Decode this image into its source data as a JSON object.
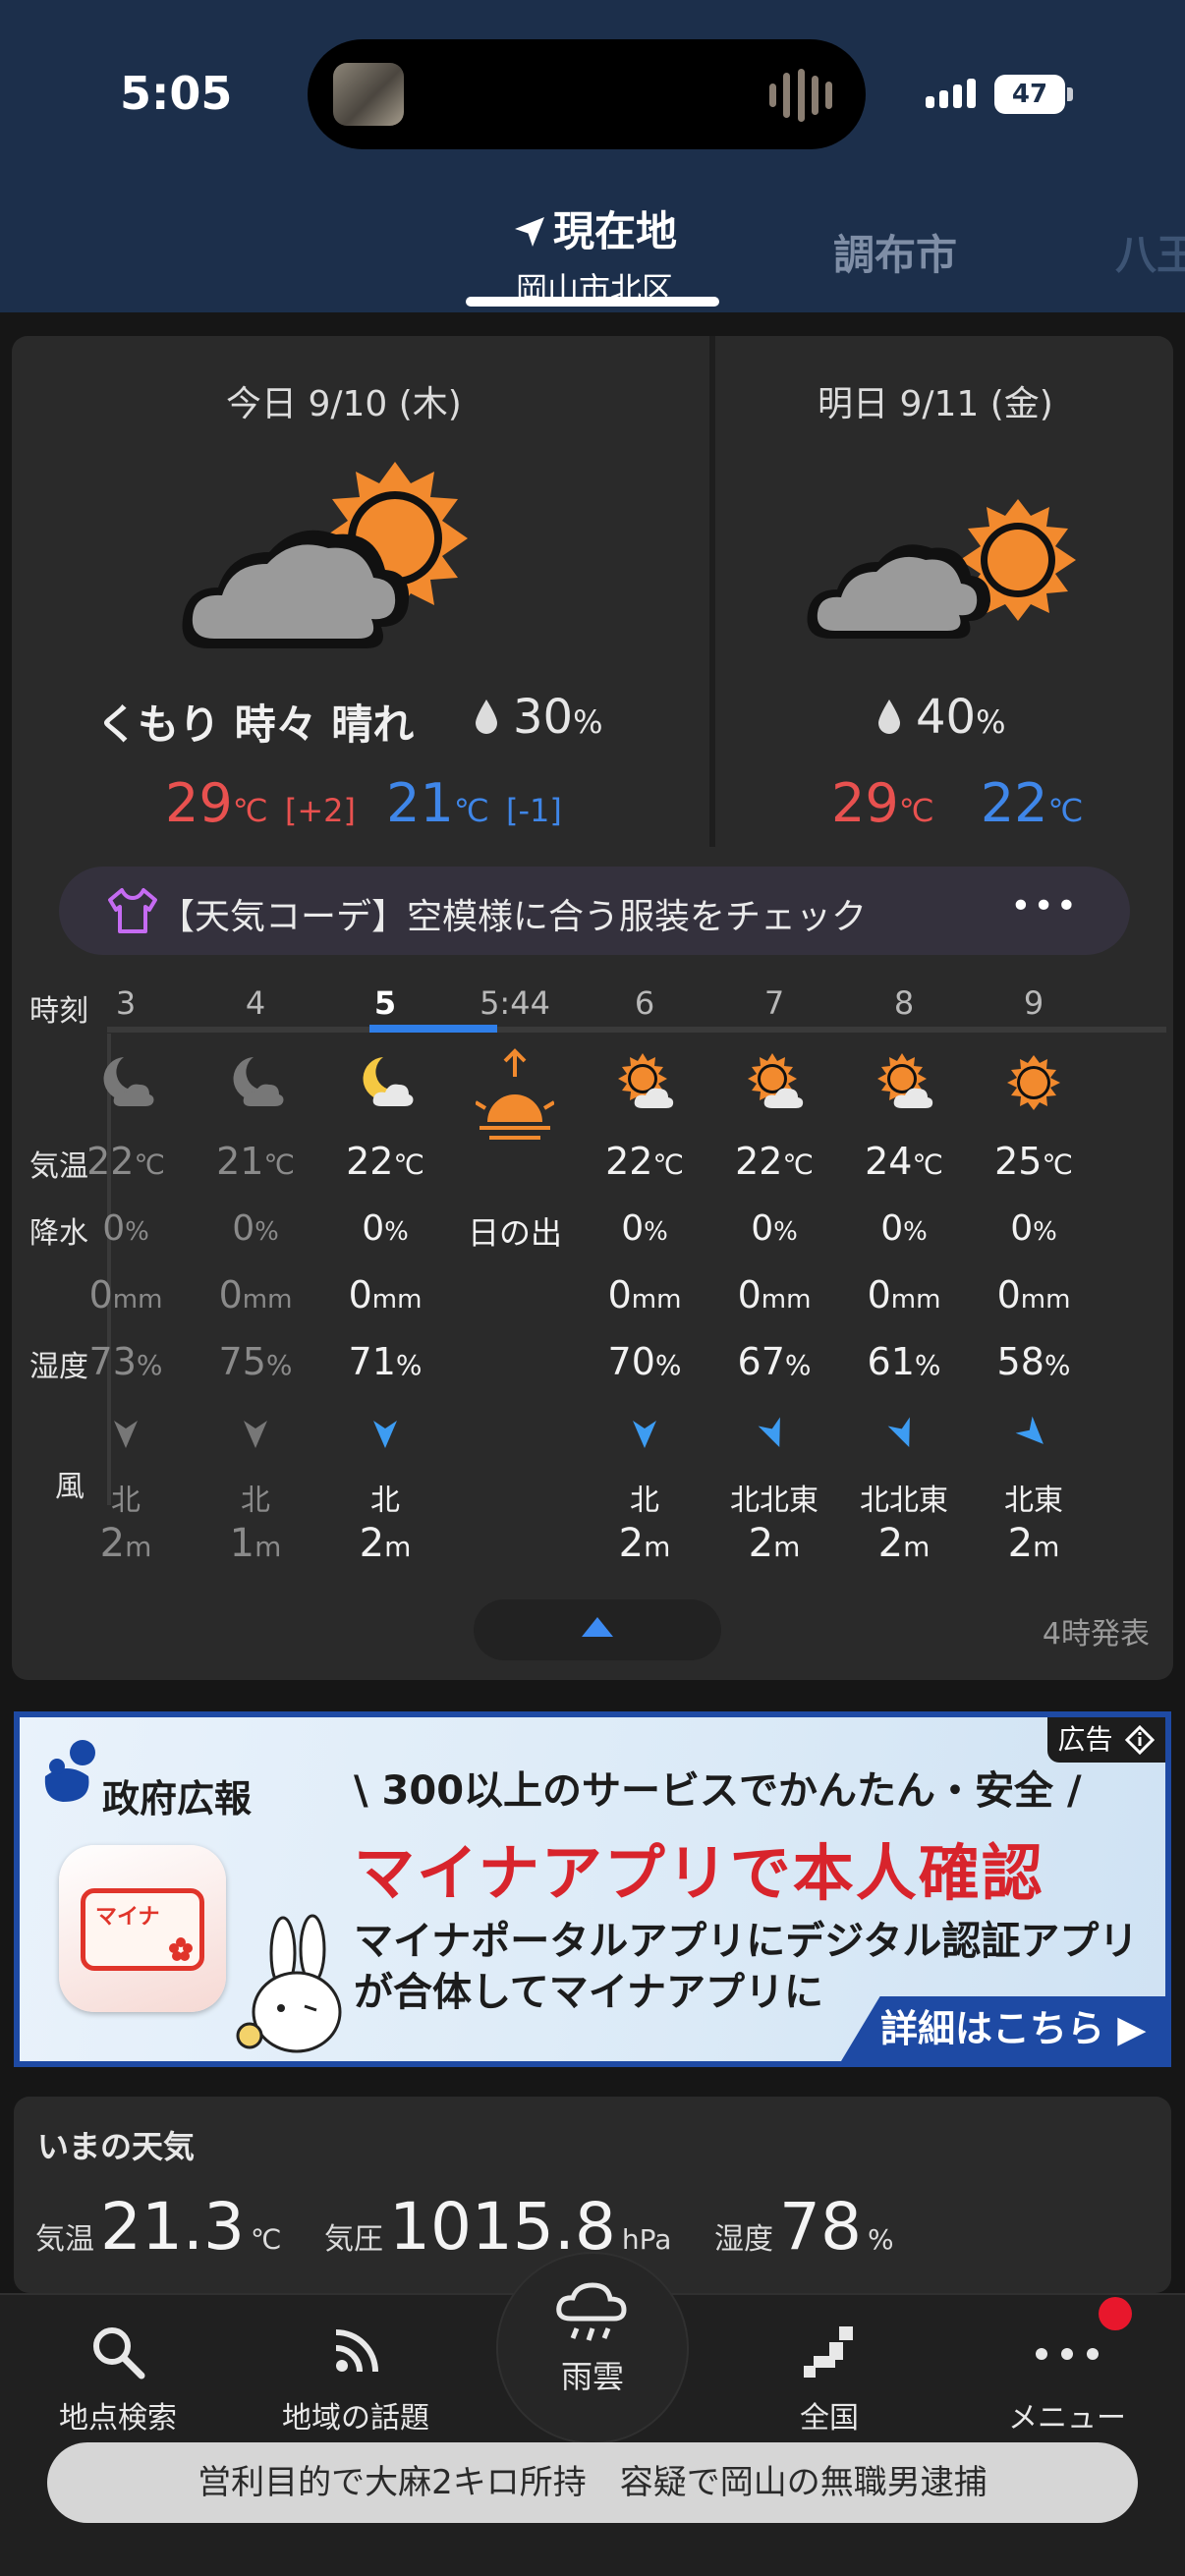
{
  "status_bar": {
    "time": "5:05",
    "battery": "47"
  },
  "tabs": {
    "current_name": "現在地",
    "current_sub": "岡山市北区",
    "next": "調布市",
    "partial": "八王"
  },
  "today": {
    "title": "今日 9/10 (木)",
    "weather": "くもり 時々 晴れ",
    "precip": "30",
    "precip_unit": "%",
    "high": "29",
    "high_diff": "[+2]",
    "low": "21",
    "low_diff": "[-1]",
    "unit": "℃"
  },
  "tomorrow": {
    "title": "明日 9/11 (金)",
    "precip": "40",
    "precip_unit": "%",
    "high": "29",
    "low": "22",
    "unit": "℃"
  },
  "coord_banner": {
    "text": "【天気コーデ】空模様に合う服装をチェック",
    "more": "•••"
  },
  "hourly": {
    "labels": {
      "time": "時刻",
      "temp": "気温",
      "rain": "降水",
      "humidity": "湿度",
      "wind": "風"
    },
    "hours": [
      {
        "hour": "3",
        "icon": "moon-cloud-icon",
        "temp": "22",
        "rain": "0",
        "mm": "0",
        "hum": "73",
        "dir": "北",
        "spd": "2",
        "past": true
      },
      {
        "hour": "4",
        "icon": "moon-cloud-icon",
        "temp": "21",
        "rain": "0",
        "mm": "0",
        "hum": "75",
        "dir": "北",
        "spd": "1",
        "past": true
      },
      {
        "hour": "5",
        "icon": "moon-cloud-icon",
        "temp": "22",
        "rain": "0",
        "mm": "0",
        "hum": "71",
        "dir": "北",
        "spd": "2",
        "past": false
      },
      {
        "hour": "5:44",
        "icon": "sunrise-icon",
        "sunrise_label": "日の出"
      },
      {
        "hour": "6",
        "icon": "sun-cloud-icon",
        "temp": "22",
        "rain": "0",
        "mm": "0",
        "hum": "70",
        "dir": "北",
        "spd": "2",
        "past": false
      },
      {
        "hour": "7",
        "icon": "sun-cloud-icon",
        "temp": "22",
        "rain": "0",
        "mm": "0",
        "hum": "67",
        "dir": "北北東",
        "spd": "2",
        "past": false
      },
      {
        "hour": "8",
        "icon": "sun-cloud-icon",
        "temp": "24",
        "rain": "0",
        "mm": "0",
        "hum": "61",
        "dir": "北北東",
        "spd": "2",
        "past": false
      },
      {
        "hour": "9",
        "icon": "sun-icon",
        "temp": "25",
        "rain": "0",
        "mm": "0",
        "hum": "58",
        "dir": "北東",
        "spd": "2",
        "past": false
      }
    ],
    "units": {
      "temp": "℃",
      "rain": "%",
      "mm": "mm",
      "hum": "%",
      "spd": "m"
    },
    "issued": "4時発表"
  },
  "ad": {
    "label": "広告",
    "sponsor": "政府広報",
    "app_card": "マイナ",
    "top_line": "\\ 300以上のサービスでかんたん・安全 /",
    "headline": "マイナアプリで本人確認",
    "body1": "マイナポータルアプリにデジタル認証アプリ",
    "body2": "が合体してマイナアプリに",
    "cta": "詳細はこちら ▶"
  },
  "now_weather": {
    "title": "いまの天気",
    "temp_label": "気温",
    "temp": "21.3",
    "temp_unit": "℃",
    "pressure_label": "気圧",
    "pressure": "1015.8",
    "pressure_unit": "hPa",
    "humidity_label": "湿度",
    "humidity": "78",
    "humidity_unit": "%"
  },
  "nav": {
    "search": "地点検索",
    "topics": "地域の話題",
    "rain": "雨雲",
    "national": "全国",
    "menu": "メニュー"
  },
  "news_ticker": "営利目的で大麻2キロ所持　容疑で岡山の無職男逮捕",
  "colors": {
    "header": "#1c2f4b",
    "high": "#e8514f",
    "low": "#3f86e8",
    "accent": "#2f7ee8",
    "sun": "#f28a2e"
  }
}
